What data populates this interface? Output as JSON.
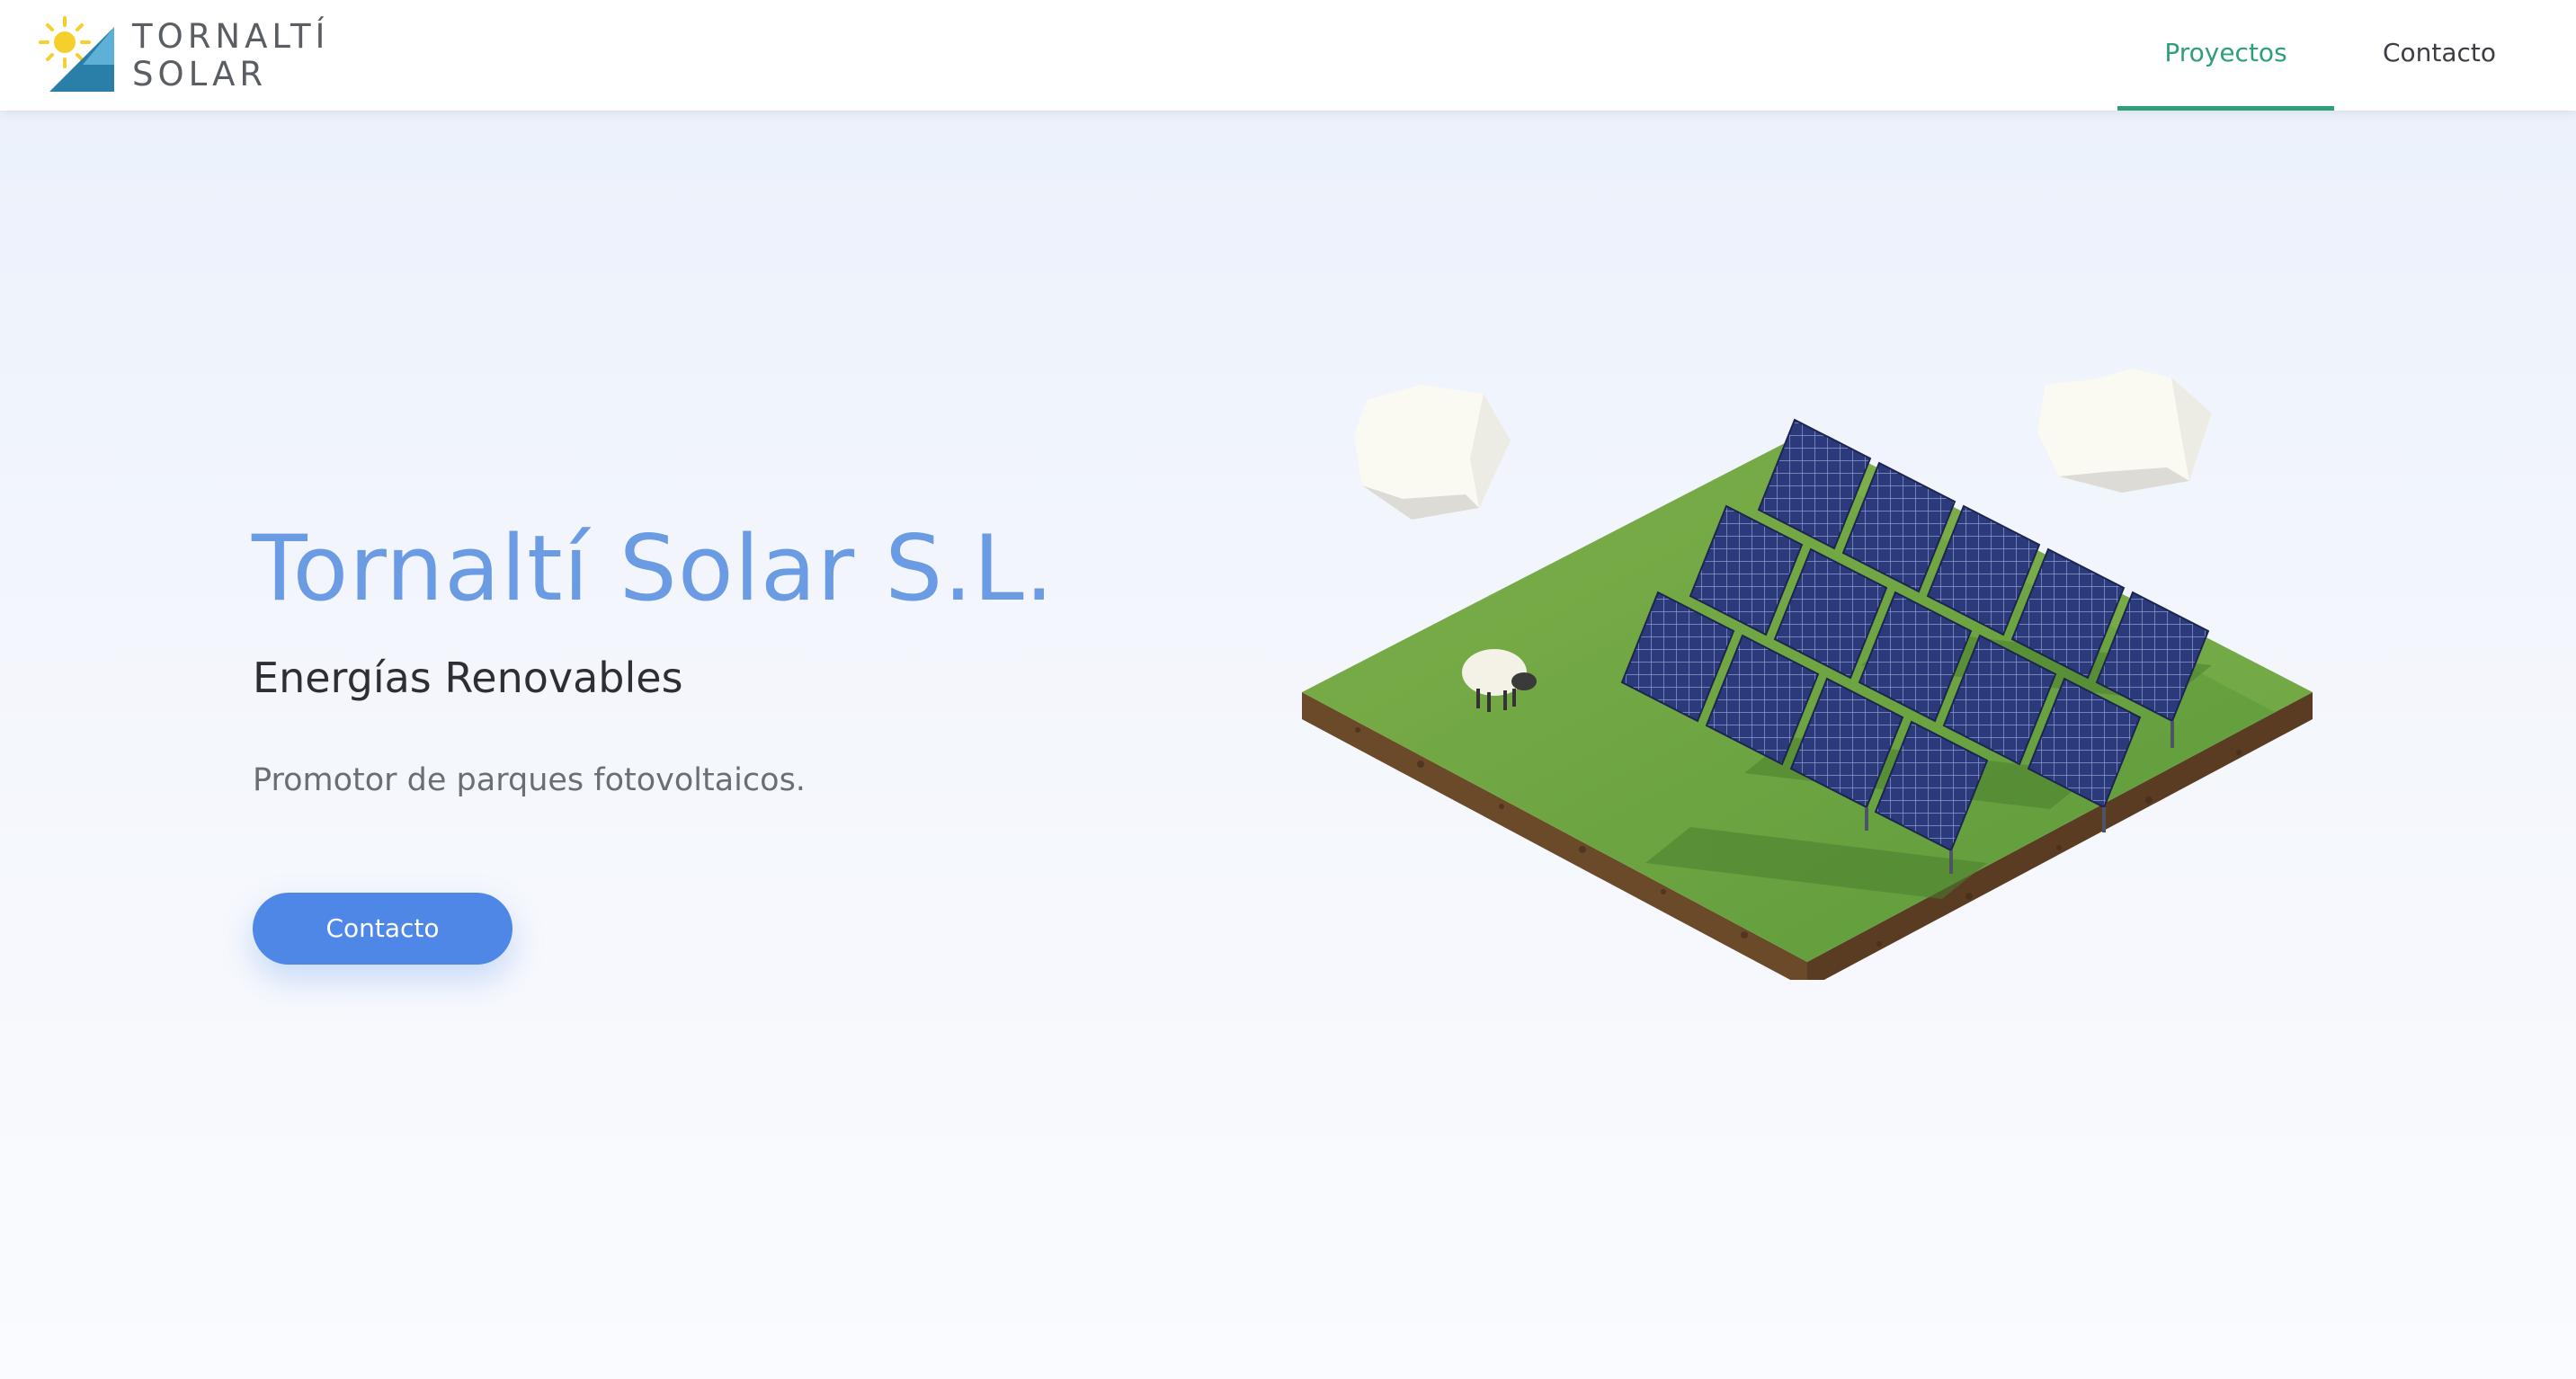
{
  "brand": {
    "line1": "TORNALTÍ",
    "line2": "SOLAR",
    "logo_icon": "sun-over-triangle-logo",
    "sun_color": "#f5cf2b",
    "triangle_colors": [
      "#2a7fa9",
      "#5fb0d6"
    ]
  },
  "nav": {
    "items": [
      {
        "label": "Proyectos",
        "active": true
      },
      {
        "label": "Contacto",
        "active": false
      }
    ],
    "active_color": "#2e9f78"
  },
  "hero": {
    "title": "Tornaltí Solar S.L.",
    "subtitle": "Energías Renovables",
    "description": "Promotor de parques fotovoltaicos.",
    "cta_label": "Contacto",
    "title_color": "#6a9be3",
    "cta_color": "#4e87e6"
  },
  "illustration": {
    "icon": "isometric-solar-farm-illustration",
    "elements": [
      "clouds",
      "sheep",
      "solar-panels",
      "grass-block"
    ]
  }
}
